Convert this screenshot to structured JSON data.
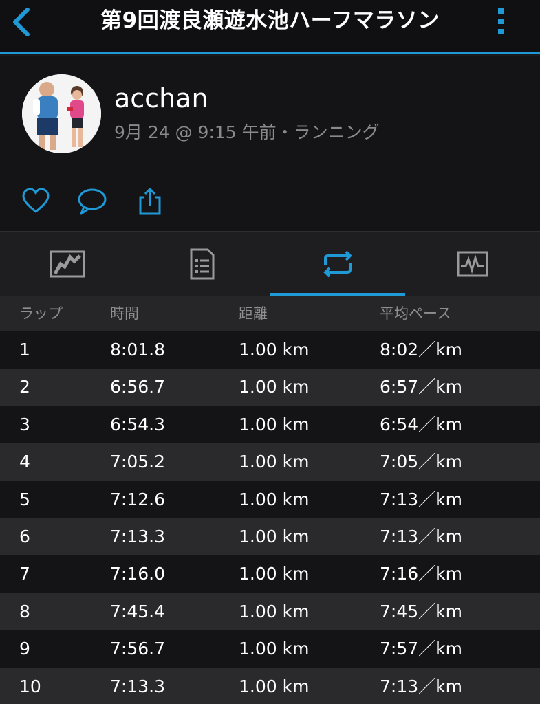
{
  "header": {
    "title": "第9回渡良瀬遊水池ハーフマラソン"
  },
  "profile": {
    "username": "acchan",
    "meta": "9月 24 @ 9:15 午前・ランニング"
  },
  "colors": {
    "accent": "#1f9ad6",
    "background": "#1b1b1d",
    "muted_text": "#8a8a8c"
  },
  "actions": [
    {
      "icon": "heart-icon"
    },
    {
      "icon": "comment-icon"
    },
    {
      "icon": "share-icon"
    }
  ],
  "tabs": [
    {
      "icon": "map-icon",
      "selected": false
    },
    {
      "icon": "details-icon",
      "selected": false
    },
    {
      "icon": "laps-icon",
      "selected": true
    },
    {
      "icon": "chart-icon",
      "selected": false
    }
  ],
  "laps": {
    "columns": [
      "ラップ",
      "時間",
      "距離",
      "平均ペース"
    ],
    "rows": [
      {
        "lap": "1",
        "time": "8:01.8",
        "distance": "1.00 km",
        "pace": "8:02／km"
      },
      {
        "lap": "2",
        "time": "6:56.7",
        "distance": "1.00 km",
        "pace": "6:57／km"
      },
      {
        "lap": "3",
        "time": "6:54.3",
        "distance": "1.00 km",
        "pace": "6:54／km"
      },
      {
        "lap": "4",
        "time": "7:05.2",
        "distance": "1.00 km",
        "pace": "7:05／km"
      },
      {
        "lap": "5",
        "time": "7:12.6",
        "distance": "1.00 km",
        "pace": "7:13／km"
      },
      {
        "lap": "6",
        "time": "7:13.3",
        "distance": "1.00 km",
        "pace": "7:13／km"
      },
      {
        "lap": "7",
        "time": "7:16.0",
        "distance": "1.00 km",
        "pace": "7:16／km"
      },
      {
        "lap": "8",
        "time": "7:45.4",
        "distance": "1.00 km",
        "pace": "7:45／km"
      },
      {
        "lap": "9",
        "time": "7:56.7",
        "distance": "1.00 km",
        "pace": "7:57／km"
      },
      {
        "lap": "10",
        "time": "7:13.3",
        "distance": "1.00 km",
        "pace": "7:13／km"
      }
    ]
  }
}
